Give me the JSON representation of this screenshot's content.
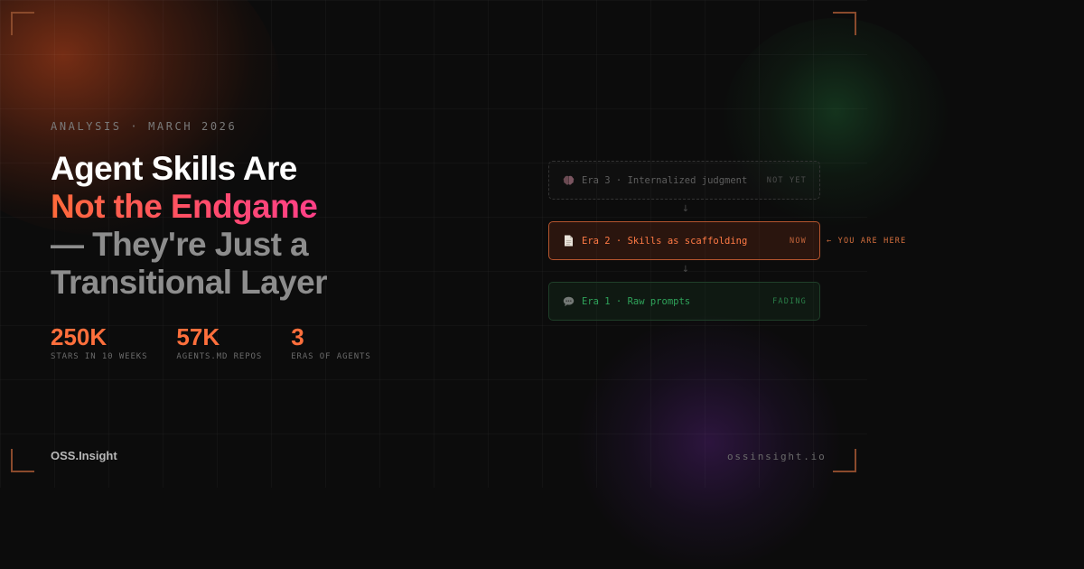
{
  "eyebrow": "ANALYSIS · MARCH 2026",
  "headline": {
    "line1": "Agent Skills Are",
    "line2": "Not the Endgame",
    "line3": "— They're Just a",
    "line4": "Transitional Layer"
  },
  "stats": [
    {
      "value": "250K",
      "label": "STARS IN 10 WEEKS"
    },
    {
      "value": "57K",
      "label": "AGENTS.MD REPOS"
    },
    {
      "value": "3",
      "label": "ERAS OF AGENTS"
    }
  ],
  "eras": [
    {
      "icon": "brain-icon",
      "label": "Era 3 · Internalized judgment",
      "status": "NOT YET"
    },
    {
      "icon": "document-icon",
      "label": "Era 2 · Skills as scaffolding",
      "status": "NOW"
    },
    {
      "icon": "speech-bubble-icon",
      "label": "Era 1 · Raw prompts",
      "status": "FADING"
    }
  ],
  "you_are_here": "← YOU ARE HERE",
  "arrow_glyph": "↓",
  "footer": {
    "brand": "OSS.Insight",
    "site": "ossinsight.io"
  },
  "colors": {
    "accent": "#ff6f3c",
    "gradient_end": "#ff3f8a",
    "era1_green": "#2fa35a",
    "background": "#0c0c0c"
  }
}
